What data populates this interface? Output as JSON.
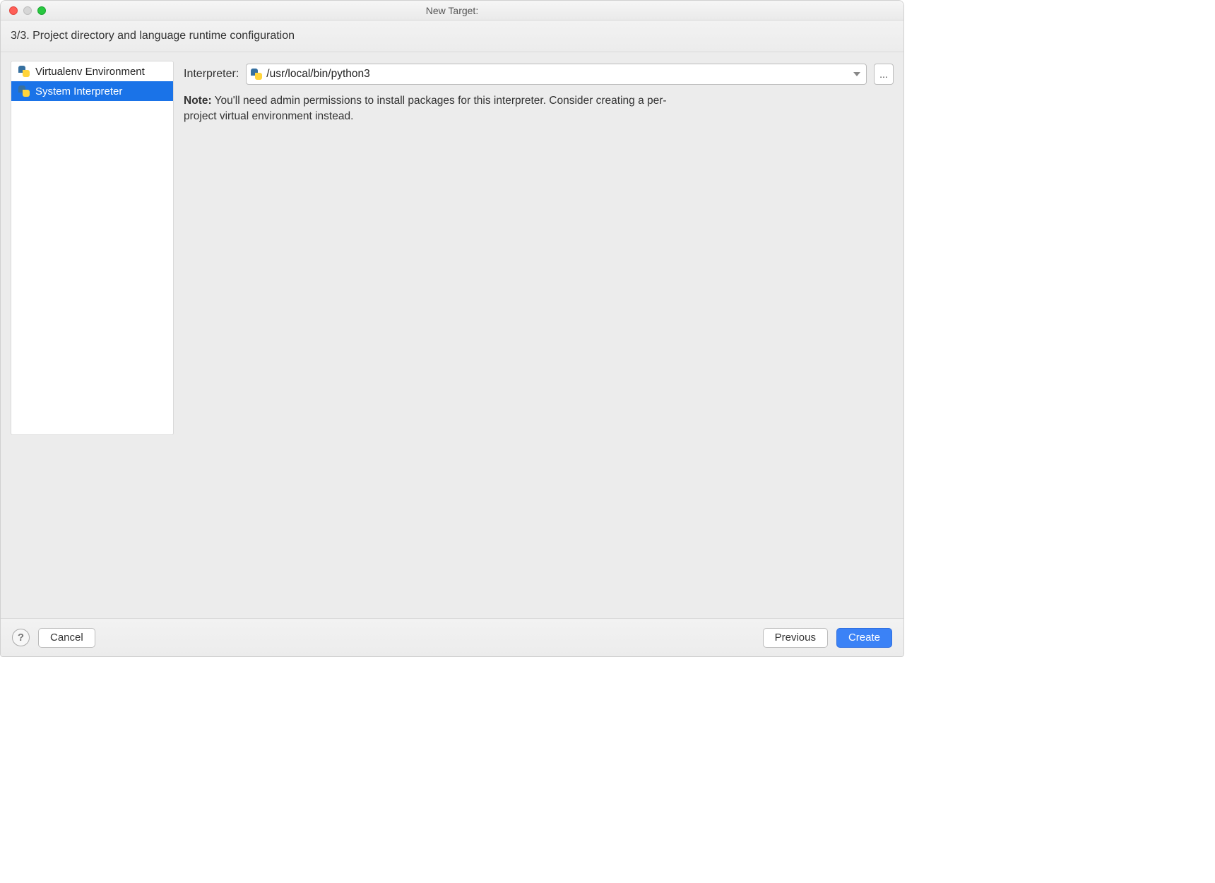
{
  "titlebar": {
    "title": "New Target:"
  },
  "subtitle": "3/3. Project directory and language runtime configuration",
  "sidebar": {
    "items": [
      {
        "label": "Virtualenv Environment",
        "selected": false
      },
      {
        "label": "System Interpreter",
        "selected": true
      }
    ]
  },
  "main": {
    "interpreter_label": "Interpreter:",
    "interpreter_value": "/usr/local/bin/python3",
    "browse_label": "...",
    "note_prefix": "Note:",
    "note_text": " You'll need admin permissions to install packages for this interpreter. Consider creating a per-project virtual environment instead."
  },
  "footer": {
    "help_label": "?",
    "cancel_label": "Cancel",
    "previous_label": "Previous",
    "create_label": "Create"
  }
}
